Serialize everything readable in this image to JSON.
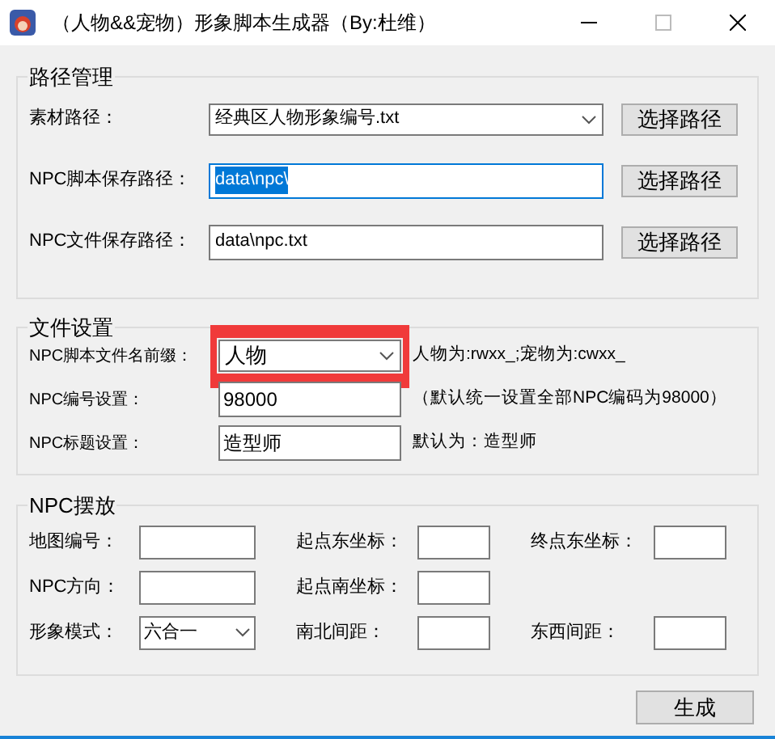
{
  "window": {
    "title": "（人物&&宠物）形象脚本生成器（By:杜维）"
  },
  "path_group": {
    "title": "路径管理",
    "rows": [
      {
        "label": "素材路径：",
        "kind": "dropdown",
        "value": "经典区人物形象编号.txt",
        "button": "选择路径"
      },
      {
        "label": "NPC脚本保存路径：",
        "kind": "text",
        "value": "data\\npc\\",
        "focused": true,
        "text_selected": true,
        "button": "选择路径"
      },
      {
        "label": "NPC文件保存路径：",
        "kind": "text",
        "value": "data\\npc.txt",
        "button": "选择路径"
      }
    ]
  },
  "file_group": {
    "title": "文件设置",
    "rows": [
      {
        "label": "NPC脚本文件名前缀：",
        "kind": "dropdown",
        "value": "人物",
        "highlighted": true,
        "note": "人物为:rwxx_;宠物为:cwxx_"
      },
      {
        "label": "NPC编号设置：",
        "kind": "text",
        "value": "98000",
        "highlighted": false,
        "note": "（默认统一设置全部NPC编码为98000）"
      },
      {
        "label": "NPC标题设置：",
        "kind": "text",
        "value": "造型师",
        "highlighted": false,
        "note": "默认为：造型师"
      }
    ]
  },
  "place_group": {
    "title": "NPC摆放",
    "rows": [
      [
        {
          "label": "地图编号：",
          "kind": "text"
        },
        {
          "label": "起点东坐标：",
          "kind": "text"
        },
        {
          "label": "终点东坐标：",
          "kind": "text"
        }
      ],
      [
        {
          "label": "NPC方向：",
          "kind": "text"
        },
        {
          "label": "起点南坐标：",
          "kind": "text"
        }
      ],
      [
        {
          "label": "形象模式：",
          "kind": "dropdown",
          "value": "六合一"
        },
        {
          "label": "南北间距：",
          "kind": "text"
        },
        {
          "label": "东西间距：",
          "kind": "text"
        }
      ]
    ]
  },
  "generate_button": "生成"
}
